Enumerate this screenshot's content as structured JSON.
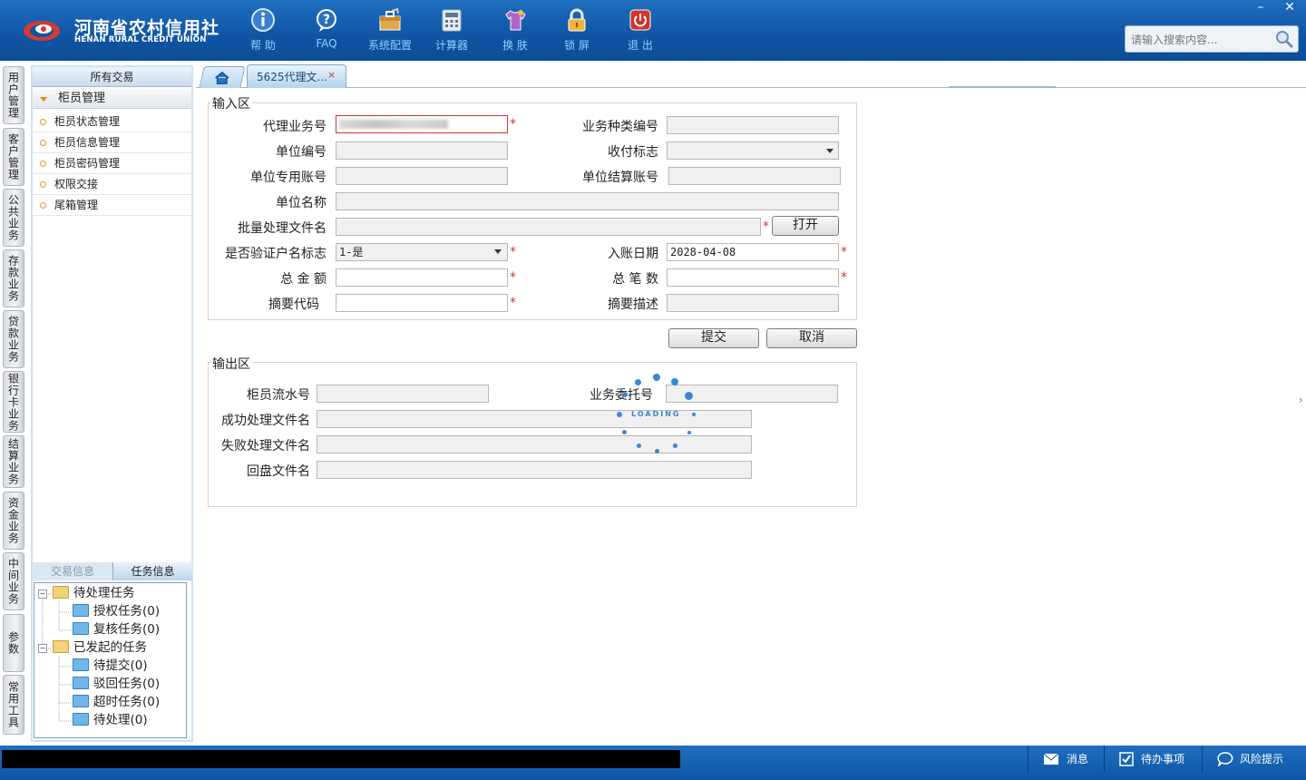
{
  "header": {
    "logo_cn": "河南省农村信用社",
    "logo_en": "HENAN RURAL CREDIT UNION",
    "toolbar": [
      {
        "label": "帮 助",
        "icon": "info-icon"
      },
      {
        "label": "FAQ",
        "icon": "help-icon"
      },
      {
        "label": "系统配置",
        "icon": "toolbox-icon"
      },
      {
        "label": "计算器",
        "icon": "calculator-icon"
      },
      {
        "label": "换 肤",
        "icon": "shirt-icon"
      },
      {
        "label": "锁 屏",
        "icon": "lock-icon"
      },
      {
        "label": "退 出",
        "icon": "power-icon"
      }
    ],
    "search_placeholder": "请输入搜索内容..."
  },
  "vtabs": [
    "用户管理",
    "客户管理",
    "公共业务",
    "存款业务",
    "贷款业务",
    "银行卡业务",
    "结算业务",
    "资金业务",
    "中间业务",
    "参数",
    "常用工具"
  ],
  "left_panel": {
    "header": "所有交易",
    "group": "柜员管理",
    "items": [
      "柜员状态管理",
      "柜员信息管理",
      "柜员密码管理",
      "权限交接",
      "尾箱管理"
    ],
    "info_tabs": [
      "交易信息",
      "任务信息"
    ],
    "tree": {
      "pending": "待处理任务",
      "pending_children": [
        "授权任务(0)",
        "复核任务(0)"
      ],
      "initiated": "已发起的任务",
      "initiated_children": [
        "待提交(0)",
        "驳回任务(0)",
        "超时任务(0)",
        "待处理(0)"
      ]
    }
  },
  "tabs": {
    "doc_tab": "5625代理文...",
    "close": "×"
  },
  "input_area": {
    "legend": "输入区",
    "agent_no_label": "代理业务号",
    "biz_type_label": "业务种类编号",
    "unit_no_label": "单位编号",
    "pay_flag_label": "收付标志",
    "unit_account_label": "单位专用账号",
    "settle_account_label": "单位结算账号",
    "unit_name_label": "单位名称",
    "batch_file_label": "批量处理文件名",
    "open_button": "打开",
    "verify_flag_label": "是否验证户名标志",
    "verify_flag_value": "1-是",
    "post_date_label": "入账日期",
    "post_date_value": "2028-04-08",
    "total_amount_label": "总 金 额",
    "total_count_label": "总 笔 数",
    "summary_code_label": "摘要代码",
    "summary_desc_label": "摘要描述",
    "required_mark": "*"
  },
  "actions": {
    "submit": "提交",
    "cancel": "取消"
  },
  "output_area": {
    "legend": "输出区",
    "teller_serial_label": "柜员流水号",
    "entrust_no_label": "业务委托号",
    "success_file_label": "成功处理文件名",
    "fail_file_label": "失败处理文件名",
    "return_file_label": "回盘文件名"
  },
  "loading_text": "LOADING",
  "status_bar": {
    "messages": "消息",
    "todo": "待办事项",
    "risk": "风险提示"
  },
  "colors": {
    "header_blue": "#0f55a4",
    "accent": "#3a86d6",
    "required": "#d43232"
  }
}
